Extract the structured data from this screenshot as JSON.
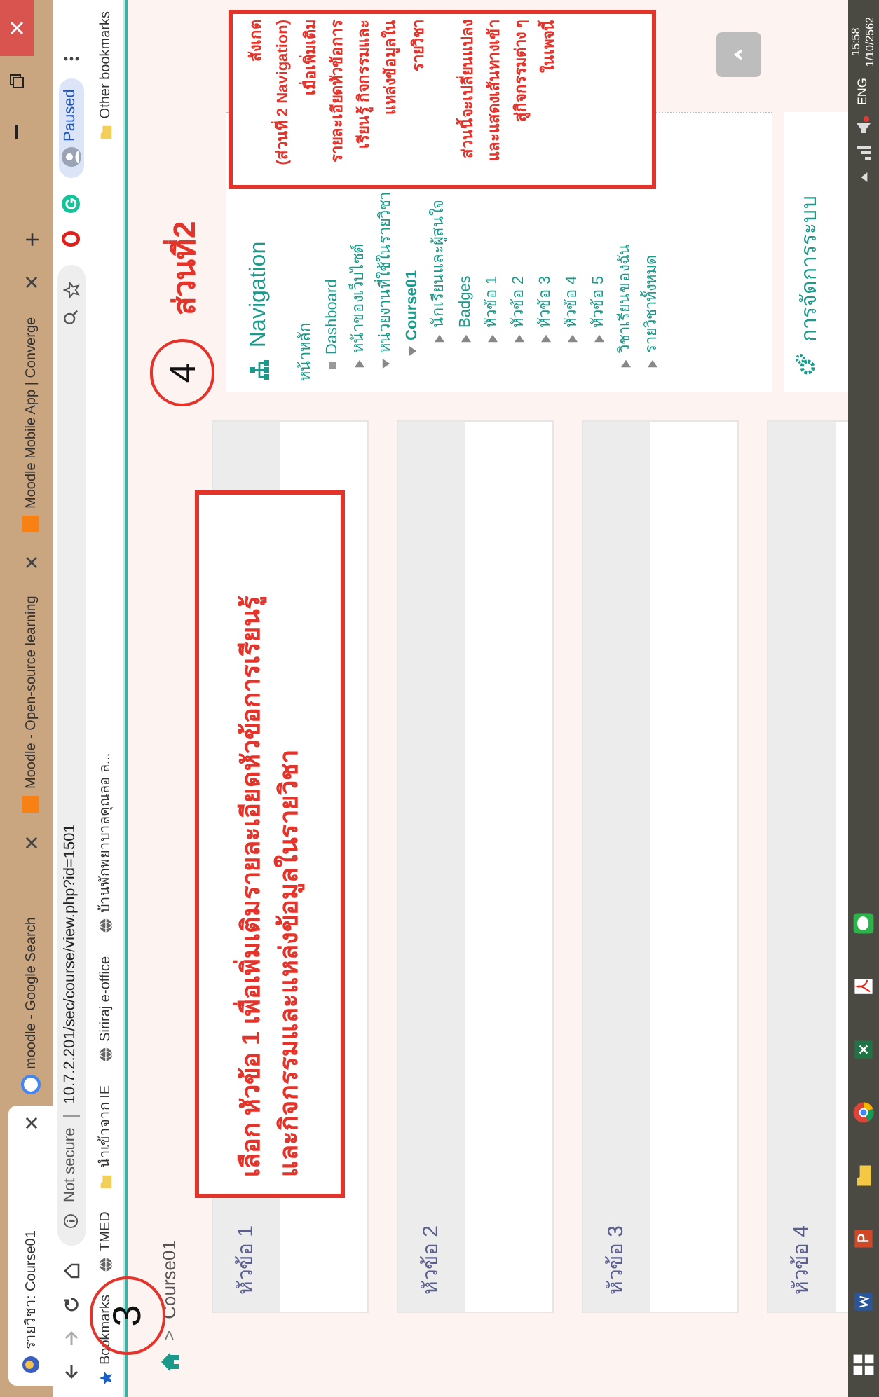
{
  "browser": {
    "tabs": [
      {
        "title": "รายวิชา: Course01",
        "selected": true
      },
      {
        "title": "moodle - Google Search",
        "selected": false
      },
      {
        "title": "Moodle - Open-source learning",
        "selected": false
      },
      {
        "title": "Moodle Mobile App | Converge",
        "selected": false
      }
    ],
    "new_tab": "+",
    "security": "Not secure",
    "url": "10.7.2.201/sec/course/view.php?id=1501",
    "profile": "Paused",
    "bookmarks": [
      {
        "label": "Bookmarks",
        "kind": "apps"
      },
      {
        "label": "TMED",
        "kind": "site"
      },
      {
        "label": "นำเข้าจาก IE",
        "kind": "folder"
      },
      {
        "label": "Siriraj e-office",
        "kind": "site"
      },
      {
        "label": "บ้านพักพยาบาลคุณลอ ล...",
        "kind": "site"
      }
    ],
    "other_bookmarks": "Other bookmarks"
  },
  "breadcrumb": {
    "separator": ">",
    "items": [
      "Course01"
    ]
  },
  "sections": [
    {
      "title": "หัวข้อ 1"
    },
    {
      "title": "หัวข้อ 2"
    },
    {
      "title": "หัวข้อ 3"
    },
    {
      "title": "หัวข้อ 4"
    }
  ],
  "navigation": {
    "title": "Navigation",
    "items": [
      {
        "label": "หน้าหลัก",
        "kind": "root",
        "children": [
          {
            "label": "Dashboard",
            "kind": "leaf"
          },
          {
            "label": "หน้าของเว็บไซต์",
            "kind": "branch",
            "expanded": false
          },
          {
            "label": "หน่วยงานที่ใช้ในรายวิชา",
            "kind": "branch",
            "expanded": true,
            "children": [
              {
                "label": "Course01",
                "kind": "branch",
                "expanded": true,
                "children": [
                  {
                    "label": "นักเรียนและผู้สนใจ",
                    "kind": "branch",
                    "expanded": false
                  },
                  {
                    "label": "Badges",
                    "kind": "branch",
                    "expanded": false
                  },
                  {
                    "label": "หัวข้อ 1",
                    "kind": "branch",
                    "expanded": false
                  },
                  {
                    "label": "หัวข้อ 2",
                    "kind": "branch",
                    "expanded": false
                  },
                  {
                    "label": "หัวข้อ 3",
                    "kind": "branch",
                    "expanded": false
                  },
                  {
                    "label": "หัวข้อ 4",
                    "kind": "branch",
                    "expanded": false
                  },
                  {
                    "label": "หัวข้อ 5",
                    "kind": "branch",
                    "expanded": false
                  }
                ]
              }
            ]
          },
          {
            "label": "วิชาเรียนของฉัน",
            "kind": "branch",
            "expanded": false
          },
          {
            "label": "รายวิชาทั้งหมด",
            "kind": "branch",
            "expanded": false
          }
        ]
      }
    ]
  },
  "admin_block": {
    "title": "การจัดการระบบ"
  },
  "annotations": {
    "marker_3": "3",
    "marker_4": "4",
    "part_label": "ส่วนที่2",
    "section_note": [
      "เลือก หัวข้อ 1 เพื่อเพิ่มเติมรายละเอียดหัวข้อการเรียนรู้",
      "และกิจกรรมและแหล่งข้อมูลในรายวิชา"
    ],
    "nav_note": [
      [
        "สังเกต",
        "(ส่วนที่ 2 Navigation)",
        "เมื่อเพิ่มเติม",
        "รายละเอียดหัวข้อการ",
        "เรียนรู้ กิจกรรมและ",
        "แหล่งข้อมูลใน",
        "รายวิชา"
      ],
      [
        "ส่วนนี้จะเปลี่ยนแปลง",
        "และแสดงเส้นทางเข้า",
        "สู่กิจกรรมต่าง ๆ",
        "ในเพจนี้"
      ]
    ]
  },
  "taskbar": {
    "language": "ENG",
    "time": "15:58",
    "date": "1/10/2562"
  }
}
